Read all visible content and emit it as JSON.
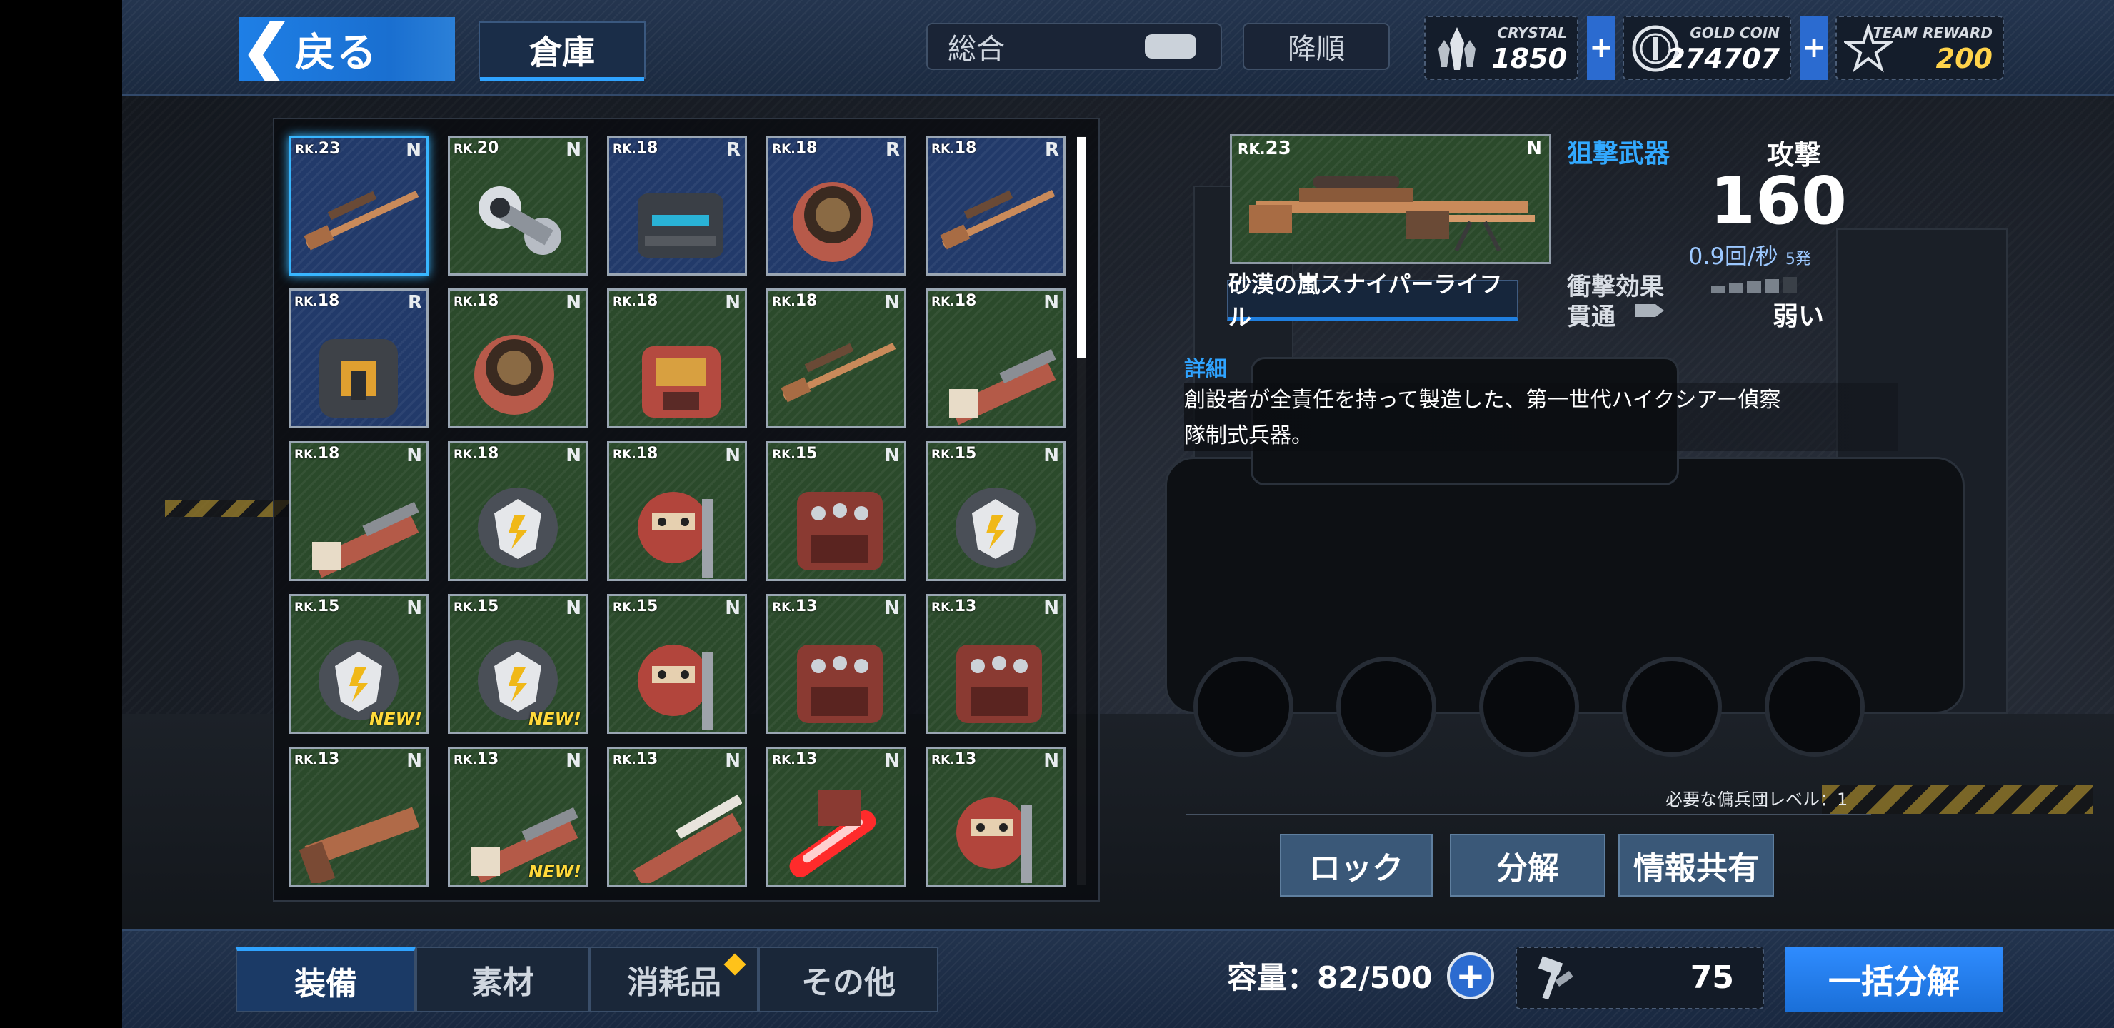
{
  "header": {
    "back_label": "戻る",
    "title_tab": "倉庫",
    "sort_label": "総合",
    "order_label": "降順",
    "currencies": [
      {
        "name": "CRYSTAL",
        "value": "1850",
        "icon": "crystal-icon"
      },
      {
        "name": "GOLD COIN",
        "value": "274707",
        "icon": "gold-coin-icon"
      },
      {
        "name": "TEAM REWARD",
        "value": "200",
        "icon": "team-reward-icon"
      }
    ],
    "plus_label": "+"
  },
  "inventory": {
    "items": [
      {
        "rk": "23",
        "rarity": "N",
        "kind": "sniper-rifle",
        "color": "blue",
        "selected": true,
        "new": false
      },
      {
        "rk": "20",
        "rarity": "N",
        "kind": "white-arm",
        "color": "green",
        "selected": false,
        "new": false
      },
      {
        "rk": "18",
        "rarity": "R",
        "kind": "chest-plate",
        "color": "blue",
        "selected": false,
        "new": false
      },
      {
        "rk": "18",
        "rarity": "R",
        "kind": "shoulder",
        "color": "blue",
        "selected": false,
        "new": false
      },
      {
        "rk": "18",
        "rarity": "R",
        "kind": "sniper-rifle",
        "color": "blue",
        "selected": false,
        "new": false
      },
      {
        "rk": "18",
        "rarity": "R",
        "kind": "leg-armor",
        "color": "blue",
        "selected": false,
        "new": false
      },
      {
        "rk": "18",
        "rarity": "N",
        "kind": "shoulder",
        "color": "green",
        "selected": false,
        "new": false
      },
      {
        "rk": "18",
        "rarity": "N",
        "kind": "chest-armor",
        "color": "green",
        "selected": false,
        "new": false
      },
      {
        "rk": "18",
        "rarity": "N",
        "kind": "sniper-rifle",
        "color": "green",
        "selected": false,
        "new": false
      },
      {
        "rk": "18",
        "rarity": "N",
        "kind": "gatling",
        "color": "green",
        "selected": false,
        "new": false
      },
      {
        "rk": "18",
        "rarity": "N",
        "kind": "gatling",
        "color": "green",
        "selected": false,
        "new": false
      },
      {
        "rk": "18",
        "rarity": "N",
        "kind": "shield-fist",
        "color": "green",
        "selected": false,
        "new": false
      },
      {
        "rk": "18",
        "rarity": "N",
        "kind": "mech-head",
        "color": "green",
        "selected": false,
        "new": false
      },
      {
        "rk": "15",
        "rarity": "N",
        "kind": "torso",
        "color": "green",
        "selected": false,
        "new": false
      },
      {
        "rk": "15",
        "rarity": "N",
        "kind": "shield-fist",
        "color": "green",
        "selected": false,
        "new": false
      },
      {
        "rk": "15",
        "rarity": "N",
        "kind": "shield-fist",
        "color": "green",
        "selected": false,
        "new": true
      },
      {
        "rk": "15",
        "rarity": "N",
        "kind": "shield-fist",
        "color": "green",
        "selected": false,
        "new": true
      },
      {
        "rk": "15",
        "rarity": "N",
        "kind": "mech-head",
        "color": "green",
        "selected": false,
        "new": false
      },
      {
        "rk": "13",
        "rarity": "N",
        "kind": "torso",
        "color": "green",
        "selected": false,
        "new": false
      },
      {
        "rk": "13",
        "rarity": "N",
        "kind": "torso",
        "color": "green",
        "selected": false,
        "new": false
      },
      {
        "rk": "13",
        "rarity": "N",
        "kind": "pistol",
        "color": "green",
        "selected": false,
        "new": false
      },
      {
        "rk": "13",
        "rarity": "N",
        "kind": "gatling",
        "color": "green",
        "selected": false,
        "new": true
      },
      {
        "rk": "13",
        "rarity": "N",
        "kind": "chainsaw",
        "color": "green",
        "selected": false,
        "new": false
      },
      {
        "rk": "13",
        "rarity": "N",
        "kind": "laser-sword",
        "color": "green",
        "selected": false,
        "new": false
      },
      {
        "rk": "13",
        "rarity": "N",
        "kind": "mech-head",
        "color": "green",
        "selected": false,
        "new": false
      }
    ],
    "rk_prefix": "RK.",
    "new_label": "NEW!"
  },
  "detail": {
    "rk": "23",
    "rarity": "N",
    "item_name": "砂漠の嵐スナイパーライフル",
    "category": "狙撃武器",
    "attack_label": "攻撃",
    "attack_value": "160",
    "fire_rate": "0.9回/秒",
    "shots": "5発",
    "impact_label": "衝撃効果",
    "impact_level": 4,
    "impact_max": 5,
    "pierce_label": "貫通",
    "pierce_value": "弱い",
    "detail_heading": "詳細",
    "description_line1": "創設者が全責任を持って製造した、第一世代ハイクシアー偵察",
    "description_line2": "隊制式兵器。",
    "requirement": "必要な傭兵団レベル：1",
    "actions": {
      "lock": "ロック",
      "dismantle": "分解",
      "share": "情報共有"
    }
  },
  "footer": {
    "tabs": [
      "装備",
      "素材",
      "消耗品",
      "その他"
    ],
    "active_tab": 0,
    "capacity": "容量：82/500",
    "hammer_count": "75",
    "bulk_dismantle": "一括分解"
  },
  "colors": {
    "accent": "#2fa3ff",
    "normal": "#2b4a2b",
    "rare": "#223a6a",
    "new": "#ffd93a"
  }
}
